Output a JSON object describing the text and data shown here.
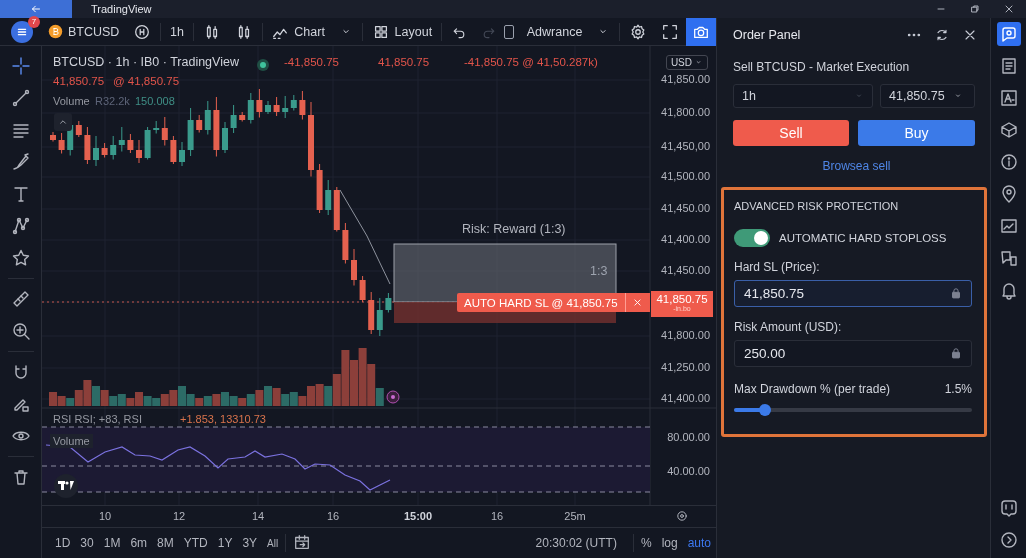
{
  "window": {
    "title": "TradingView"
  },
  "toolbar": {
    "notification_count": "7",
    "symbol": "BTCUSD",
    "interval": "1h",
    "chart_label": "Chart",
    "layout_label": "Layout",
    "template_label": "Adwrance",
    "template_checked": false,
    "undo_disabled": false,
    "redo_disabled": true
  },
  "tools": [
    {
      "selected": true
    },
    {
      "selected": false
    },
    {
      "selected": false
    },
    {
      "selected": false
    },
    {
      "selected": false
    },
    {
      "selected": false
    },
    {
      "selected": false
    },
    {
      "selected": false
    },
    {
      "selected": false
    },
    {
      "selected": false
    },
    {
      "selected": false
    },
    {
      "selected": false
    },
    {
      "selected": false
    }
  ],
  "legend": {
    "title": "BTCUSD · 1h · IB0 · TradingView",
    "values": [
      "-41,850.75",
      "41,850.75",
      "-41,850.75 @ 41,50.287k)"
    ],
    "line2": [
      "41,850.75",
      "@ 41,850.75"
    ],
    "volume_label": "Volume",
    "volume_values": [
      {
        "text": "R32.2k",
        "color": "#5d6478"
      },
      {
        "text": "150.008",
        "color": "#3f8f86"
      }
    ]
  },
  "currency": "USD",
  "price_axis": [
    "41,850.00",
    "41,800.00",
    "41,450,00",
    "41,500.00",
    "41,450.00",
    "41,400.00",
    "41,450.00",
    "41,800.00",
    "41,250.00",
    "41,400.00"
  ],
  "current_price": {
    "value": "41,850.75",
    "sub": "-in.bo"
  },
  "risk_reward": {
    "title": "Risk: Reward (1:3)",
    "ratio": "1:3"
  },
  "stop_loss_label": "AUTO HARD SL @ 41,850.75",
  "rsi": {
    "label": "RSI RSI; +83, RSI",
    "values": "+1.853, 13310.73",
    "volume_label": "Volume",
    "axis": [
      "80.00.00",
      "40.00.00"
    ]
  },
  "time_axis": [
    {
      "text": "10",
      "bold": false
    },
    {
      "text": "12",
      "bold": false
    },
    {
      "text": "14",
      "bold": false
    },
    {
      "text": "16",
      "bold": false
    },
    {
      "text": "15:00",
      "bold": true
    },
    {
      "text": "16",
      "bold": false
    },
    {
      "text": "25m",
      "bold": false
    }
  ],
  "ranges": [
    "1D",
    "30",
    "1M",
    "6m",
    "8M",
    "YTD",
    "1Y",
    "3Y",
    "All"
  ],
  "clock": "20:30:02 (UTT)",
  "scale_options": [
    {
      "label": "%",
      "selected": false
    },
    {
      "label": "log",
      "selected": false
    },
    {
      "label": "auto",
      "selected": true
    }
  ],
  "order_panel": {
    "title": "Order Panel",
    "subtitle": "Sell BTCUSD - Market Execution",
    "interval": "1h",
    "price": "41,850.75",
    "sell": "Sell",
    "buy": "Buy",
    "link": "Browsea sell",
    "risk": {
      "heading": "ADVANCED RISK PROTECTION",
      "toggle": {
        "label": "AUTOMATIC HARD STOPLOSS",
        "on": true
      },
      "fields": [
        {
          "label": "Hard SL (Price):",
          "value": "41,850.75",
          "focused": true
        },
        {
          "label": "Risk Amount (USD):",
          "value": "250.00",
          "focused": false
        }
      ],
      "slider": {
        "label": "Max Drawdown % (per trade)",
        "reading": "1.5%",
        "level": 0.13
      }
    }
  },
  "side_icons": [
    {
      "selected": true
    },
    {
      "selected": false
    },
    {
      "selected": false
    },
    {
      "selected": false
    },
    {
      "selected": false
    },
    {
      "selected": false
    },
    {
      "selected": false
    },
    {
      "selected": false
    },
    {
      "selected": false
    },
    {
      "selected": false
    },
    {
      "selected": false
    }
  ]
}
